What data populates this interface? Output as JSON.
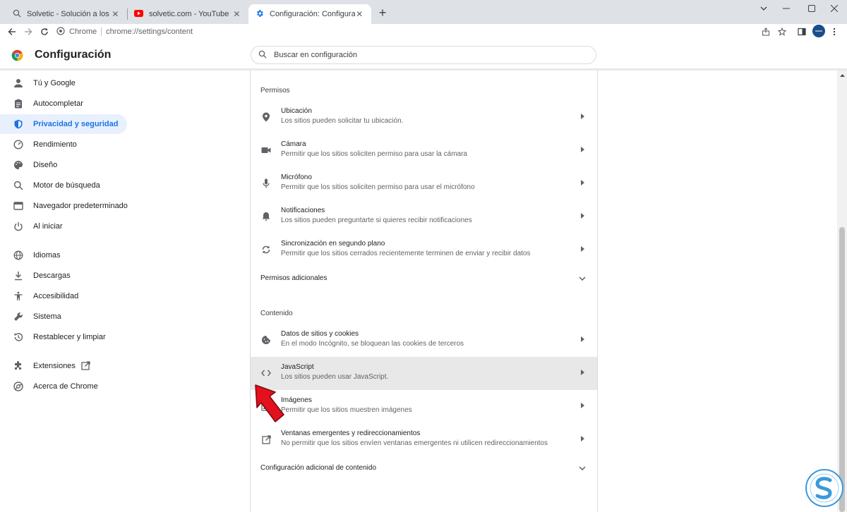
{
  "browser": {
    "tabs": [
      {
        "title": "Solvetic - Solución a los problem",
        "icon": "solvetic-search-icon"
      },
      {
        "title": "solvetic.com - YouTube",
        "icon": "youtube-icon"
      },
      {
        "title": "Configuración: Configuración de",
        "icon": "settings-gear-icon"
      }
    ],
    "omnibox": {
      "site": "Chrome",
      "url": "chrome://settings/content"
    }
  },
  "header": {
    "title": "Configuración",
    "search_placeholder": "Buscar en configuración"
  },
  "sidebar": {
    "items": [
      {
        "label": "Tú y Google",
        "icon": "person-icon"
      },
      {
        "label": "Autocompletar",
        "icon": "clipboard-icon"
      },
      {
        "label": "Privacidad y seguridad",
        "icon": "shield-icon",
        "active": true
      },
      {
        "label": "Rendimiento",
        "icon": "speedometer-icon"
      },
      {
        "label": "Diseño",
        "icon": "palette-icon"
      },
      {
        "label": "Motor de búsqueda",
        "icon": "search-icon"
      },
      {
        "label": "Navegador predeterminado",
        "icon": "browser-window-icon"
      },
      {
        "label": "Al iniciar",
        "icon": "power-icon"
      },
      {
        "label": "Idiomas",
        "icon": "globe-icon"
      },
      {
        "label": "Descargas",
        "icon": "download-icon"
      },
      {
        "label": "Accesibilidad",
        "icon": "accessibility-icon"
      },
      {
        "label": "Sistema",
        "icon": "wrench-icon"
      },
      {
        "label": "Restablecer y limpiar",
        "icon": "history-reset-icon"
      },
      {
        "label": "Extensiones",
        "icon": "puzzle-icon"
      },
      {
        "label": "Acerca de Chrome",
        "icon": "chrome-icon"
      }
    ]
  },
  "main": {
    "permisos": {
      "title": "Permisos",
      "rows": [
        {
          "title": "Ubicación",
          "subtitle": "Los sitios pueden solicitar tu ubicación.",
          "icon": "location-pin-icon"
        },
        {
          "title": "Cámara",
          "subtitle": "Permitir que los sitios soliciten permiso para usar la cámara",
          "icon": "camera-icon"
        },
        {
          "title": "Micrófono",
          "subtitle": "Permitir que los sitios soliciten permiso para usar el micrófono",
          "icon": "microphone-icon"
        },
        {
          "title": "Notificaciones",
          "subtitle": "Los sitios pueden preguntarte si quieres recibir notificaciones",
          "icon": "bell-icon"
        },
        {
          "title": "Sincronización en segundo plano",
          "subtitle": "Permitir que los sitios cerrados recientemente terminen de enviar y recibir datos",
          "icon": "sync-icon"
        }
      ],
      "additional": "Permisos adicionales"
    },
    "contenido": {
      "title": "Contenido",
      "rows": [
        {
          "title": "Datos de sitios y cookies",
          "subtitle": "En el modo Incógnito, se bloquean las cookies de terceros",
          "icon": "cookie-icon"
        },
        {
          "title": "JavaScript",
          "subtitle": "Los sitios pueden usar JavaScript.",
          "icon": "code-brackets-icon",
          "highlighted": true
        },
        {
          "title": "Imágenes",
          "subtitle": "Permitir que los sitios muestren imágenes",
          "icon": "image-icon"
        },
        {
          "title": "Ventanas emergentes y redireccionamientos",
          "subtitle": "No permitir que los sitios envíen ventanas emergentes ni utilicen redireccionamientos",
          "icon": "open-in-new-icon"
        }
      ],
      "additional": "Configuración adicional de contenido"
    }
  },
  "colors": {
    "accent": "#1a73e8",
    "active_bg": "#e8f0fe",
    "highlight_row": "#e8e8e8",
    "arrow_red": "#e3101e"
  }
}
